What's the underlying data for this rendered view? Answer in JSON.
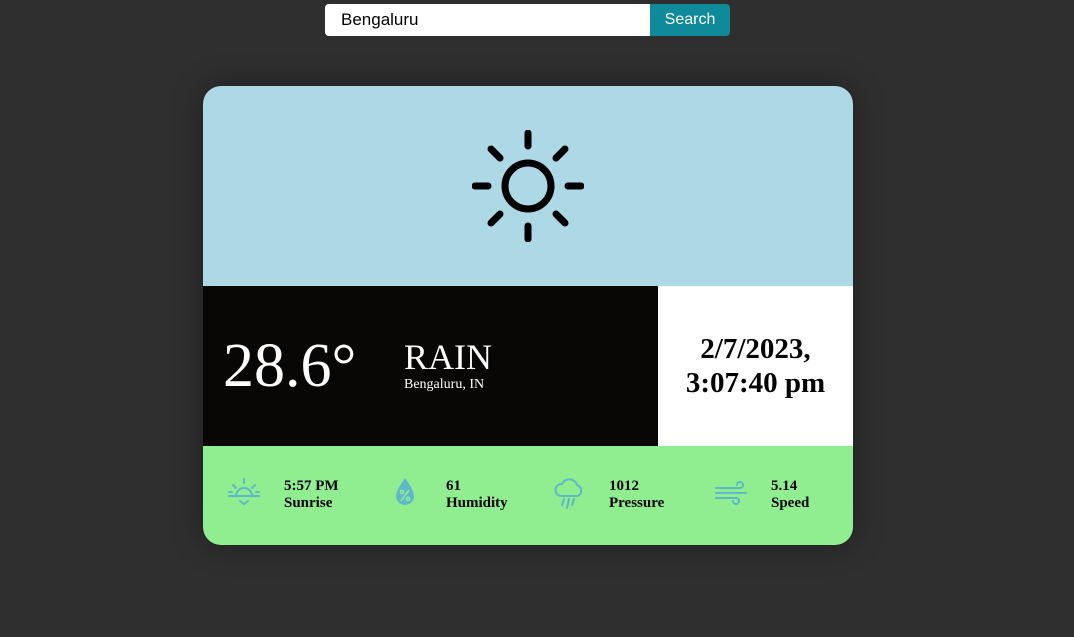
{
  "search": {
    "value": "Bengaluru",
    "button_label": "Search"
  },
  "weather": {
    "icon": "sun-icon",
    "temperature": "28.6°",
    "condition": "RAIN",
    "location": "Bengaluru, IN",
    "date": "2/7/2023,",
    "time": "3:07:40 pm"
  },
  "stats": [
    {
      "icon": "sunrise-icon",
      "value": "5:57 PM",
      "label": "Sunrise"
    },
    {
      "icon": "humidity-icon",
      "value": "61",
      "label": "Humidity"
    },
    {
      "icon": "pressure-icon",
      "value": "1012",
      "label": "Pressure"
    },
    {
      "icon": "wind-icon",
      "value": "5.14",
      "label": "Speed"
    }
  ],
  "colors": {
    "background": "#2f2f2f",
    "button": "#0e8a9a",
    "icon_panel": "#add8e6",
    "temp_panel": "#080706",
    "stats_panel": "#90ee90",
    "stat_icon": "#5fb8c8"
  }
}
